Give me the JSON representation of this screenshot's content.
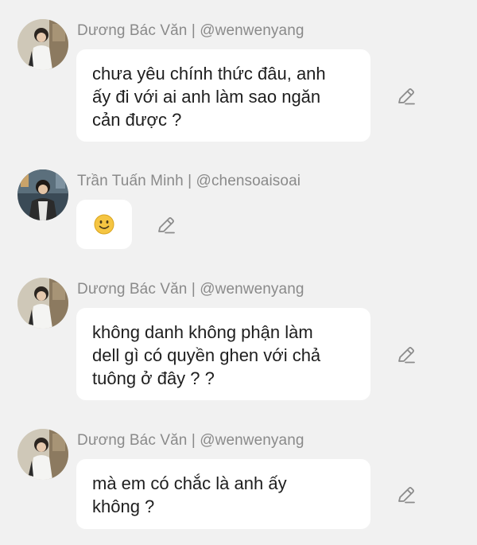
{
  "messages": [
    {
      "author_name": "Dương Bác Văn",
      "handle": "@wenwenyang",
      "header": "Dương Bác Văn | @wenwenyang",
      "text": "chưa yêu chính thức đâu, anh\nấy đi với ai anh làm sao ngăn\ncản được ?",
      "avatar": "avatar-photo-duong-bac-van",
      "edit_icon": "pencil-icon"
    },
    {
      "author_name": "Trần Tuấn Minh",
      "handle": "@chensoaisoai",
      "header": "Trần Tuấn Minh | @chensoaisoai",
      "text": "",
      "emoji": "slightly-smiling-face",
      "avatar": "avatar-photo-tran-tuan-minh",
      "edit_icon": "pencil-icon"
    },
    {
      "author_name": "Dương Bác Văn",
      "handle": "@wenwenyang",
      "header": "Dương Bác Văn | @wenwenyang",
      "text": "không danh không phận làm\ndell gì có quyền ghen với chả\ntuông ở đây ? ?",
      "avatar": "avatar-photo-duong-bac-van",
      "edit_icon": "pencil-icon"
    },
    {
      "author_name": "Dương Bác Văn",
      "handle": "@wenwenyang",
      "header": "Dương Bác Văn | @wenwenyang",
      "text": "mà em có chắc là anh ấy\nkhông ?",
      "avatar": "avatar-photo-duong-bac-van",
      "edit_icon": "pencil-icon"
    }
  ],
  "colors": {
    "background": "#f1f1f1",
    "bubble": "#ffffff",
    "name": "#8a8a8a",
    "text": "#1e1e1e",
    "icon": "#8c8c8c",
    "emoji": "#f5c542"
  }
}
